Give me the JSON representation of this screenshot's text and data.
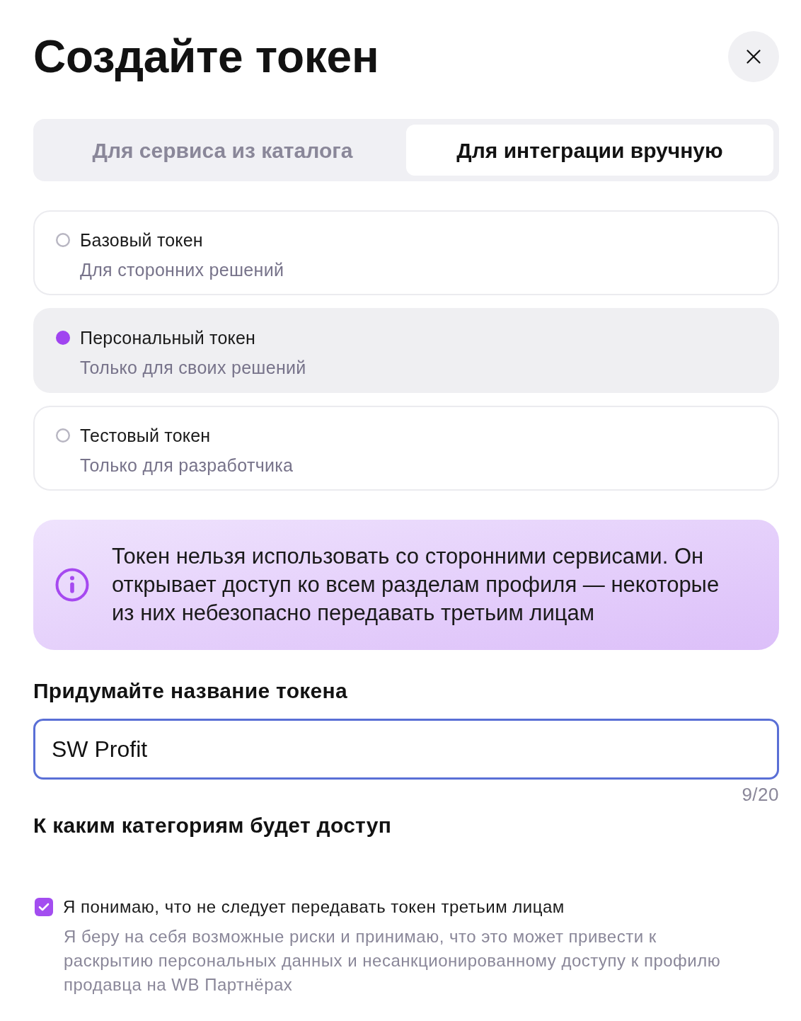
{
  "title": "Создайте токен",
  "tabs": [
    {
      "label": "Для сервиса из каталога",
      "selected": false
    },
    {
      "label": "Для интеграции вручную",
      "selected": true
    }
  ],
  "token_types": [
    {
      "title": "Базовый токен",
      "subtitle": "Для сторонних решений",
      "selected": false
    },
    {
      "title": "Персональный токен",
      "subtitle": "Только для своих решений",
      "selected": true
    },
    {
      "title": "Тестовый токен",
      "subtitle": "Только для разработчика",
      "selected": false
    }
  ],
  "notice": {
    "text": "Токен нельзя использовать со сторонними сервисами. Он открывает доступ ко всем разделам профиля — некоторые из них небезопасно передавать третьим лицам"
  },
  "name_field": {
    "label": "Придумайте название токена",
    "value": "SW Profit",
    "counter": "9/20"
  },
  "categories": {
    "heading": "К каким категориям будет доступ"
  },
  "consent": {
    "checked": true,
    "label": "Я понимаю, что не следует передавать токен третьим лицам",
    "description": "Я беру на себя возможные риски и принимаю, что это может привести к раскрытию персональных данных и несанкционированному доступу к профилю продавца на WB Партнёрах"
  }
}
